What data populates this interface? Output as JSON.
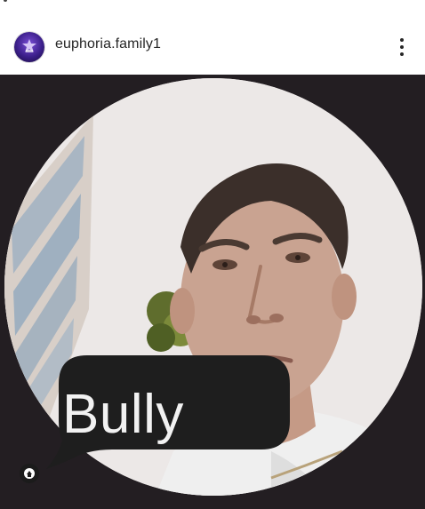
{
  "post": {
    "username": "euphoria.family1",
    "avatar_icon": "euphoria-logo-icon",
    "more_icon": "more-options-icon"
  },
  "media": {
    "bubble_text": "Bully",
    "sound_icon": "sound-toggle-icon"
  },
  "colors": {
    "media_background": "#231e22",
    "bubble": "#1e1e1e",
    "bubble_text": "#f2f2f2",
    "username": "#262626"
  }
}
